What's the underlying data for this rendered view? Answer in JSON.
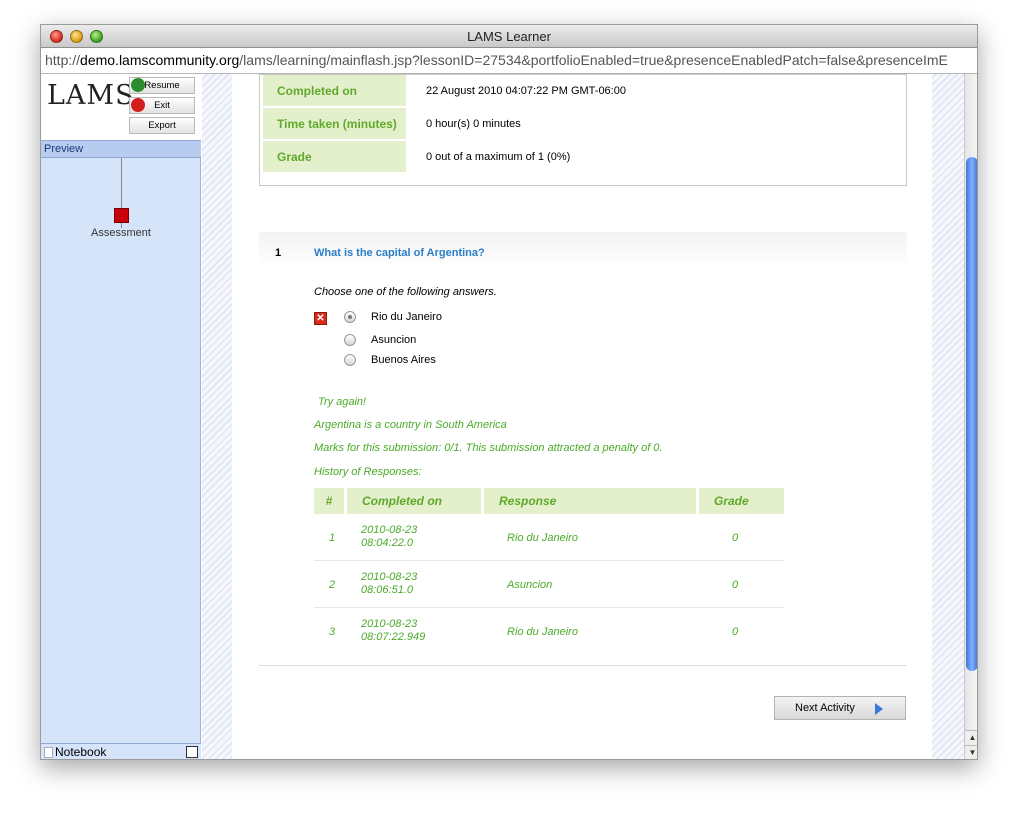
{
  "window": {
    "title": "LAMS Learner"
  },
  "urlbar": {
    "prefix": "http://",
    "domain": "demo.lamscommunity.org",
    "path": "/lams/learning/mainflash.jsp?lessonID=27534&portfolioEnabled=true&presenceEnabledPatch=false&presenceImE"
  },
  "sidebar": {
    "logo": "LAMS",
    "resume_label": "Resume",
    "exit_label": "Exit",
    "export_label": "Export",
    "preview_label": "Preview",
    "activity_label": "Assessment",
    "notebook_label": "Notebook"
  },
  "summary": [
    {
      "label": "Completed on",
      "value": "22 August 2010 04:07:22 PM GMT-06:00"
    },
    {
      "label": "Time taken (minutes)",
      "value": "0 hour(s) 0 minutes"
    },
    {
      "label": "Grade",
      "value": "0 out of a maximum of 1 (0%)"
    }
  ],
  "question": {
    "number": "1",
    "text": "What is the capital of Argentina?",
    "instruction": "Choose one of the following answers.",
    "options": [
      "Rio du Janeiro",
      "Asuncion",
      "Buenos Aires"
    ],
    "selected_index": 0
  },
  "feedback": {
    "try_again": "Try again!",
    "hint": "Argentina is a country in South America",
    "marks": "Marks for this submission: 0/1. This submission attracted a penalty of 0.",
    "history_label": "History of Responses:"
  },
  "history": {
    "headers": [
      "#",
      "Completed on",
      "Response",
      "Grade"
    ],
    "rows": [
      {
        "num": "1",
        "date": "2010-08-23",
        "time": "08:04:22.0",
        "response": "Rio du Janeiro",
        "grade": "0"
      },
      {
        "num": "2",
        "date": "2010-08-23",
        "time": "08:06:51.0",
        "response": "Asuncion",
        "grade": "0"
      },
      {
        "num": "3",
        "date": "2010-08-23",
        "time": "08:07:22.949",
        "response": "Rio du Janeiro",
        "grade": "0"
      }
    ]
  },
  "next_button": {
    "label": "Next Activity"
  },
  "colors": {
    "accent_green": "#5faa2a",
    "question_blue": "#2a7ec8",
    "header_bg": "#e4efcc"
  }
}
